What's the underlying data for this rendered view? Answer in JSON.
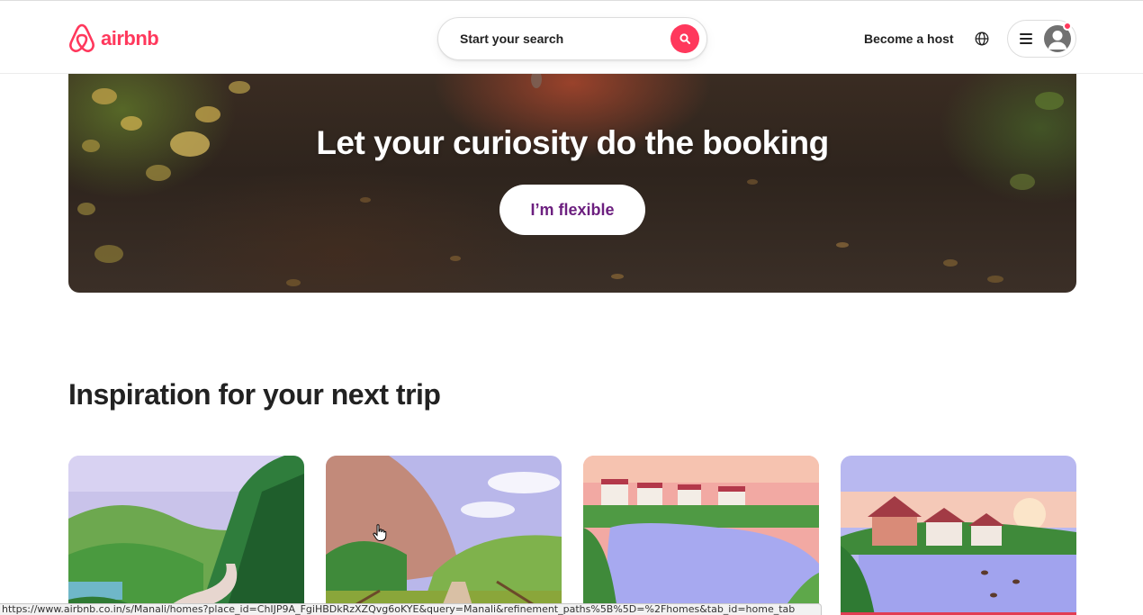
{
  "brand": {
    "name": "airbnb",
    "color": "#ff385c"
  },
  "header": {
    "search_placeholder": "Start your search",
    "host_link": "Become a host",
    "icons": [
      "airbnb-logo-icon",
      "search-icon",
      "globe-icon",
      "menu-icon",
      "user-avatar-icon"
    ]
  },
  "hero": {
    "title": "Let your curiosity do the booking",
    "button_label": "I’m flexible",
    "button_text_color": "#6c1f7f"
  },
  "inspiration": {
    "title": "Inspiration for your next trip",
    "cards": [
      {
        "illustration": "green-mountains-river-road"
      },
      {
        "illustration": "rocky-cliff-fenced-path"
      },
      {
        "illustration": "pink-sky-lake-village"
      },
      {
        "illustration": "sunset-lake-house-ducks"
      }
    ]
  },
  "status_bar": {
    "url": "https://www.airbnb.co.in/s/Manali/homes?place_id=ChIJP9A_FgiHBDkRzXZQvg6oKYE&query=Manali&refinement_paths%5B%5D=%2Fhomes&tab_id=home_tab"
  }
}
